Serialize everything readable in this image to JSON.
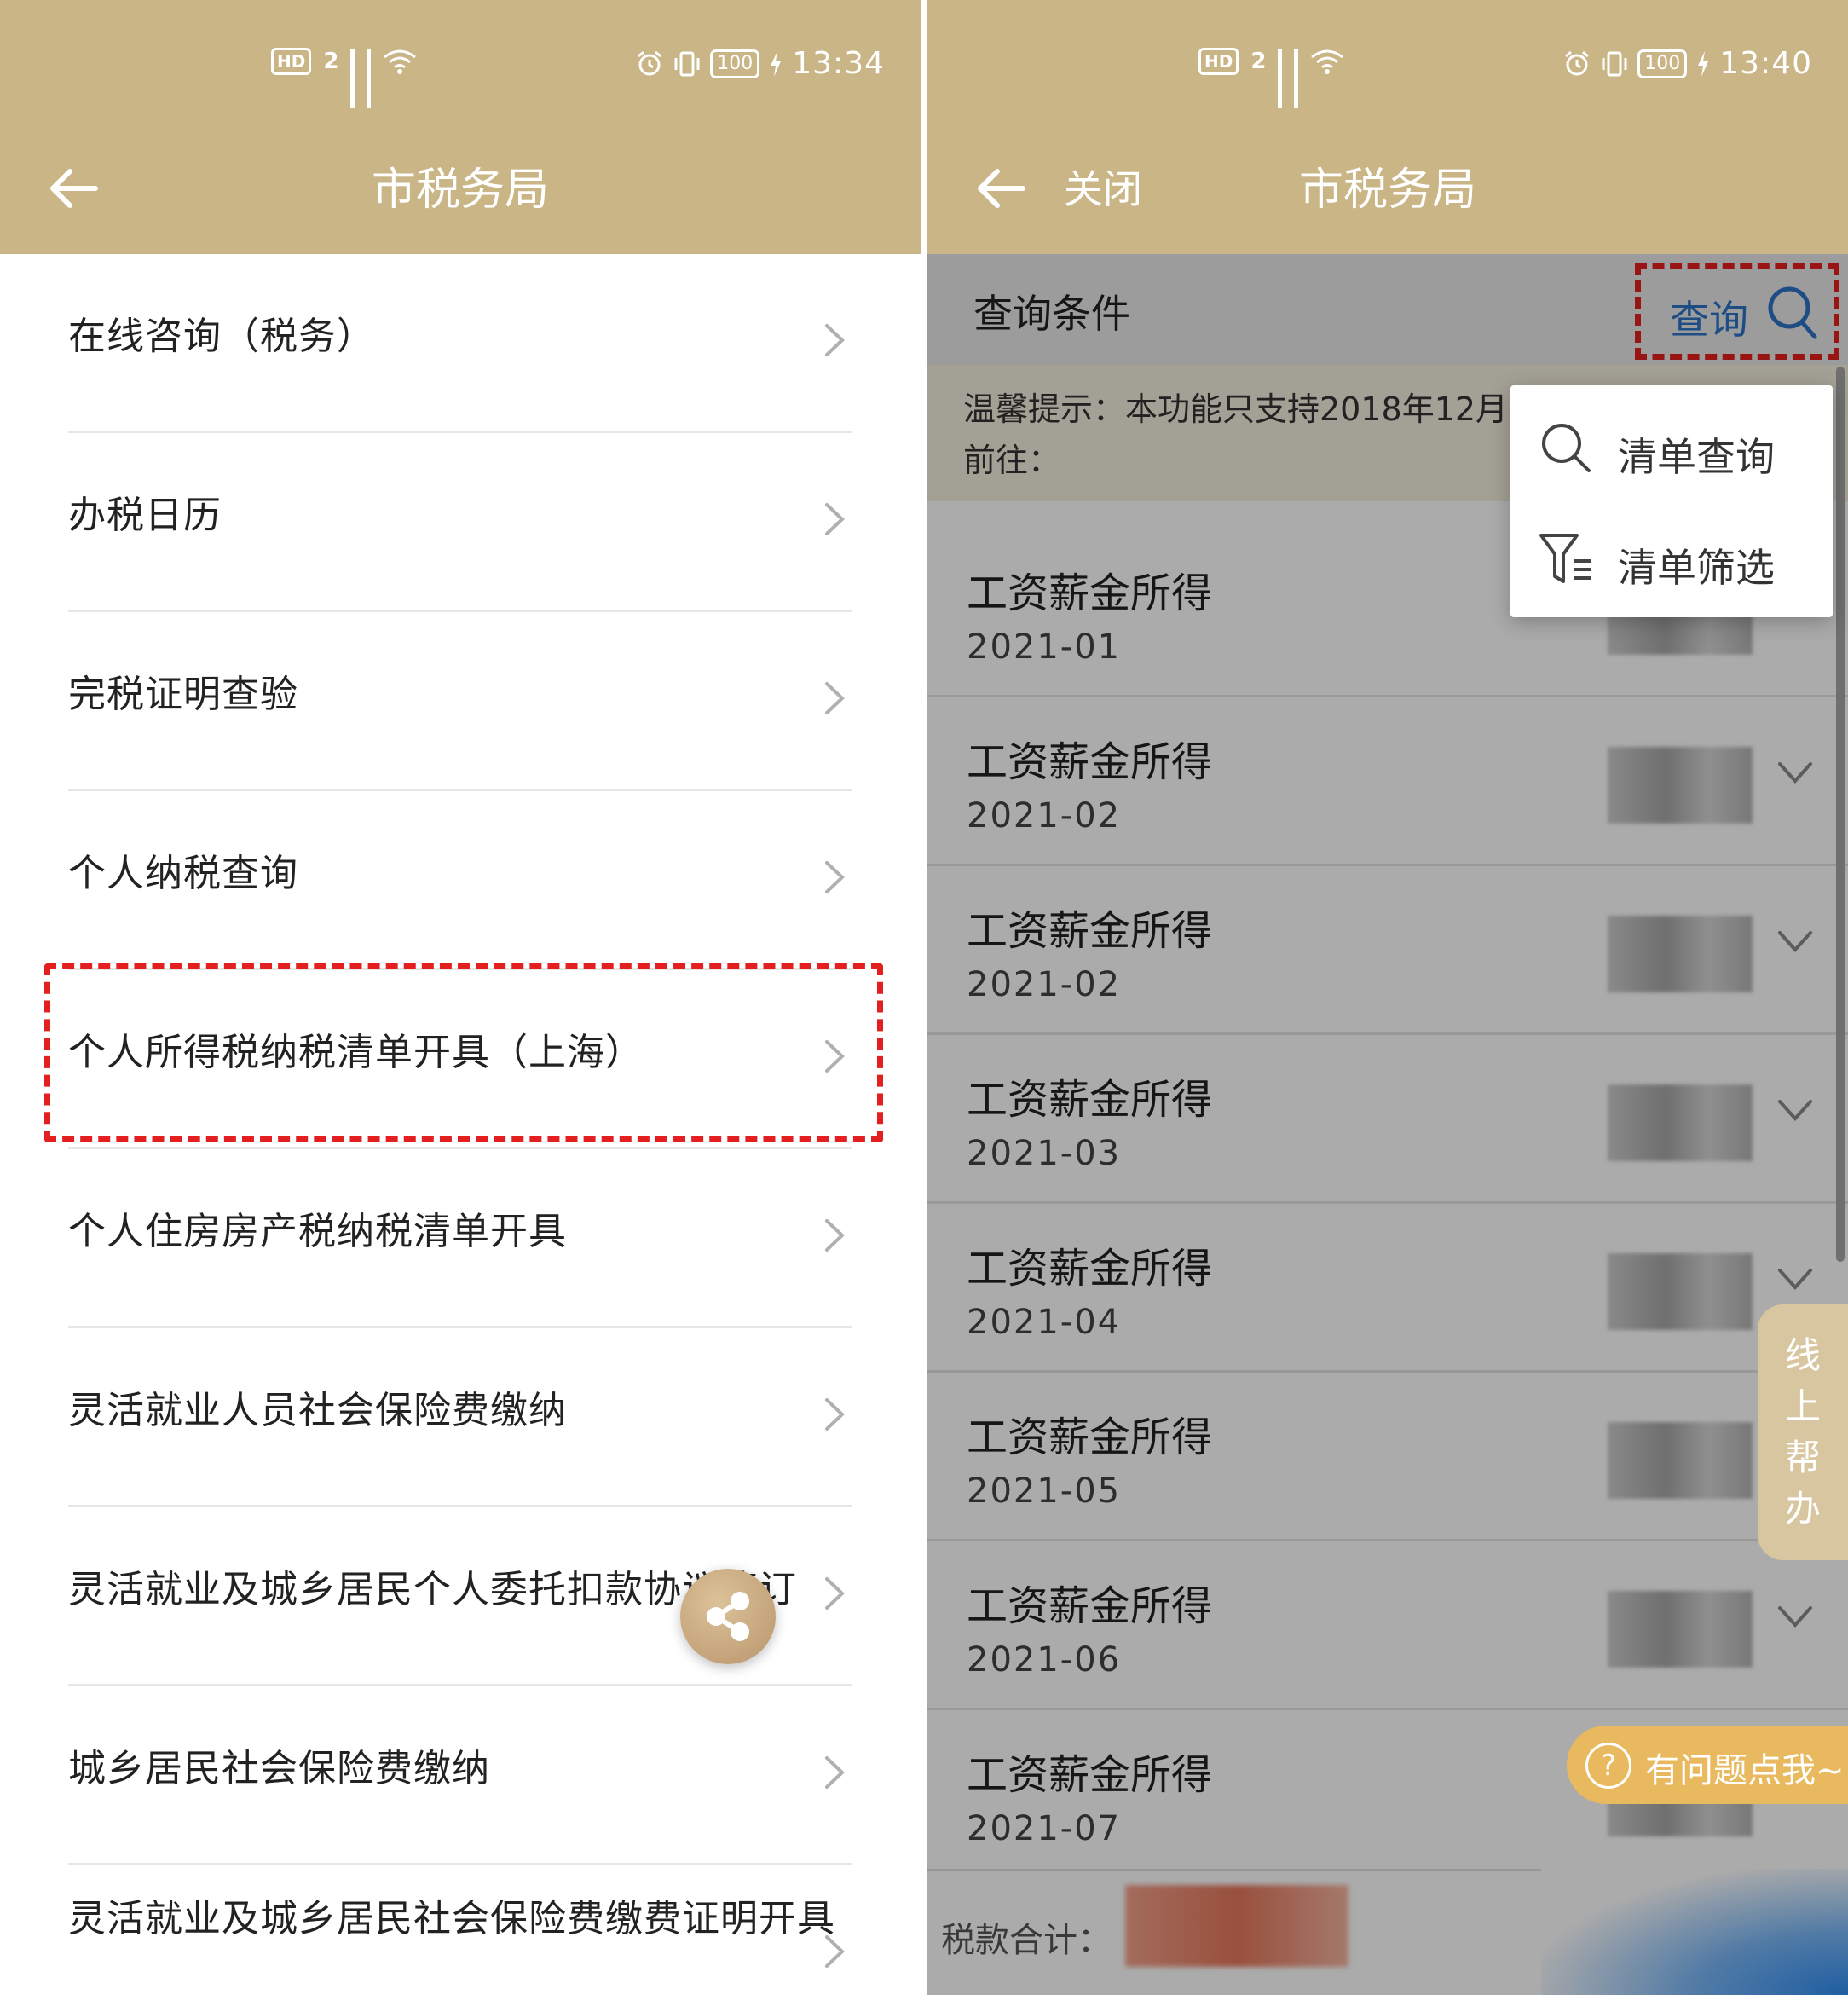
{
  "left": {
    "status": {
      "time": "13:34",
      "battery": "100",
      "net1": "2G",
      "net2": "5G"
    },
    "title": "市税务局",
    "menu": [
      {
        "label": "在线咨询（税务）"
      },
      {
        "label": "办税日历"
      },
      {
        "label": "完税证明查验"
      },
      {
        "label": "个人纳税查询"
      },
      {
        "label": "个人所得税纳税清单开具（上海）"
      },
      {
        "label": "个人住房房产税纳税清单开具"
      },
      {
        "label": "灵活就业人员社会保险费缴纳"
      },
      {
        "label": "灵活就业及城乡居民个人委托扣款协议签订"
      },
      {
        "label": "城乡居民社会保险费缴纳"
      },
      {
        "label": "灵活就业及城乡居民社会保险费缴费证明开具"
      }
    ]
  },
  "right": {
    "status": {
      "time": "13:40",
      "battery": "100",
      "net1": "2G",
      "net2": "5G"
    },
    "close_label": "关闭",
    "title": "市税务局",
    "condition_label": "查询条件",
    "query_label": "查询",
    "tip_line1": "温馨提示：本功能只支持2018年12月",
    "tip_line2": "前往：",
    "popup": [
      {
        "label": "清单查询",
        "icon": "search-icon"
      },
      {
        "label": "清单筛选",
        "icon": "filter-icon"
      }
    ],
    "records": [
      {
        "title": "工资薪金所得",
        "date": "2021-01"
      },
      {
        "title": "工资薪金所得",
        "date": "2021-02"
      },
      {
        "title": "工资薪金所得",
        "date": "2021-02"
      },
      {
        "title": "工资薪金所得",
        "date": "2021-03"
      },
      {
        "title": "工资薪金所得",
        "date": "2021-04"
      },
      {
        "title": "工资薪金所得",
        "date": "2021-05"
      },
      {
        "title": "工资薪金所得",
        "date": "2021-06"
      },
      {
        "title": "工资薪金所得",
        "date": "2021-07"
      }
    ],
    "side_tab_label": "线上帮办",
    "help_label": "有问题点我~",
    "help_icon_text": "?",
    "total_label": "税款合计："
  },
  "colors": {
    "header": "#c9b586",
    "highlight": "#e3201f",
    "link": "#2d72c6",
    "help": "#e8b95e"
  }
}
